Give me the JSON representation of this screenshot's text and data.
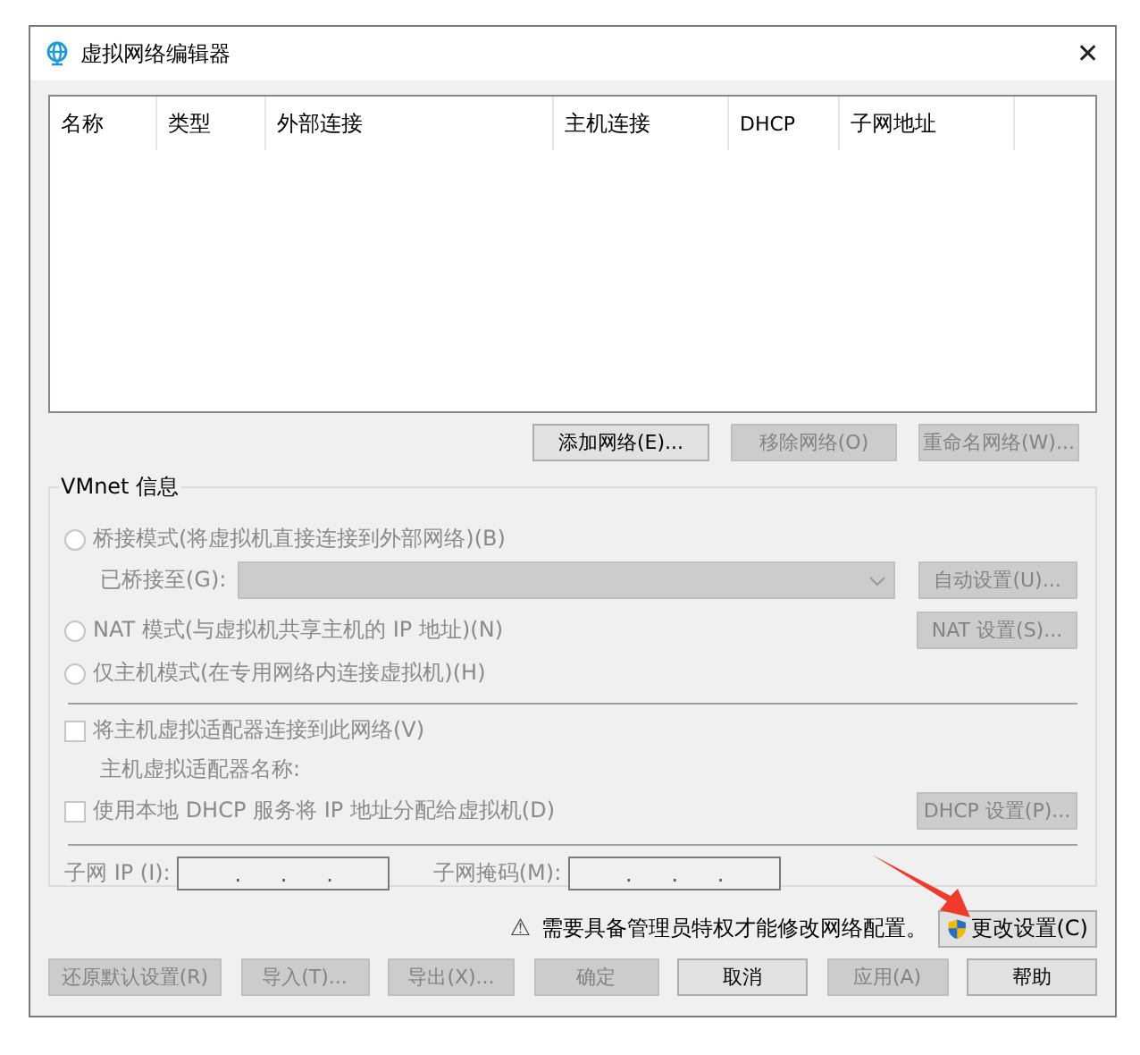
{
  "window": {
    "title": "虚拟网络编辑器",
    "close": "✕"
  },
  "table": {
    "columns": [
      "名称",
      "类型",
      "外部连接",
      "主机连接",
      "DHCP",
      "子网地址"
    ]
  },
  "list_buttons": [
    {
      "label": "添加网络(E)...",
      "disabled": false
    },
    {
      "label": "移除网络(O)",
      "disabled": true
    },
    {
      "label": "重命名网络(W)...",
      "disabled": true
    }
  ],
  "vmnet_info": {
    "title": "VMnet 信息",
    "bridged": {
      "label": "桥接模式(将虚拟机直接连接到外部网络)(B)",
      "selected": false,
      "disabled": true
    },
    "bridged_to": {
      "label": "已桥接至(G):",
      "button": "自动设置(U)...",
      "disabled": true
    },
    "nat": {
      "label": "NAT 模式(与虚拟机共享主机的 IP 地址)(N)",
      "selected": false,
      "disabled": true,
      "button": "NAT 设置(S)..."
    },
    "host_only": {
      "label": "仅主机模式(在专用网络内连接虚拟机)(H)",
      "selected": false,
      "disabled": true
    },
    "connect_adapter": {
      "label": "将主机虚拟适配器连接到此网络(V)",
      "checked": false,
      "disabled": true
    },
    "adapter_name": {
      "label": "主机虚拟适配器名称:"
    },
    "use_dhcp": {
      "label": "使用本地 DHCP 服务将 IP 地址分配给虚拟机(D)",
      "checked": false,
      "disabled": true,
      "button": "DHCP 设置(P)..."
    },
    "subnet_ip": {
      "label": "子网 IP (I):",
      "dots": [
        ".",
        ".",
        "."
      ]
    },
    "subnet_mask": {
      "label": "子网掩码(M):",
      "dots": [
        ".",
        ".",
        "."
      ]
    }
  },
  "admin_notice": {
    "icon": "⚠",
    "text": "需要具备管理员特权才能修改网络配置。",
    "button": "更改设置(C)"
  },
  "footer_buttons": [
    {
      "label": "还原默认设置(R)",
      "disabled": true
    },
    {
      "label": "导入(T)...",
      "disabled": true
    },
    {
      "label": "导出(X)...",
      "disabled": true
    },
    {
      "label": "确定",
      "disabled": true
    },
    {
      "label": "取消",
      "disabled": false
    },
    {
      "label": "应用(A)",
      "disabled": true
    },
    {
      "label": "帮助",
      "disabled": false
    }
  ]
}
